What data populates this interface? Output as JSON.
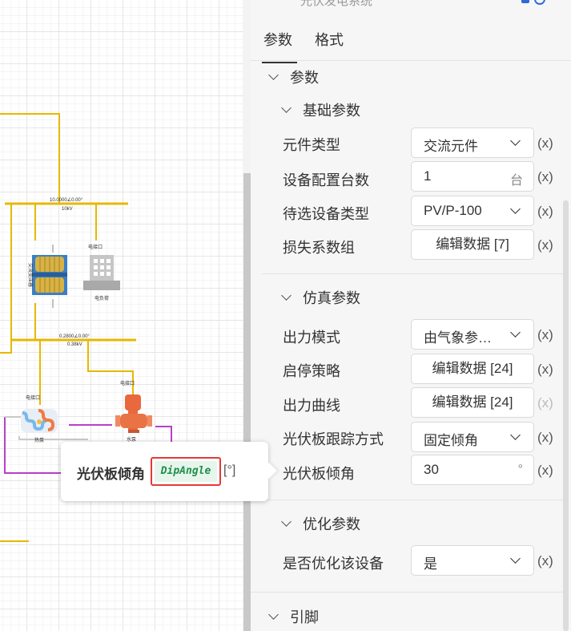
{
  "panel": {
    "title": "光伏发电系统",
    "tabs": [
      {
        "label": "参数",
        "active": true
      },
      {
        "label": "格式",
        "active": false
      }
    ]
  },
  "sections": {
    "params_label": "参数",
    "basic_label": "基础参数",
    "sim_label": "仿真参数",
    "opt_label": "优化参数",
    "pins_label": "引脚"
  },
  "basic_rows": [
    {
      "label": "元件类型",
      "type": "select",
      "value": "交流元件",
      "x": "(x)"
    },
    {
      "label": "设备配置台数",
      "type": "number",
      "value": "1",
      "unit": "台",
      "x": "(x)"
    },
    {
      "label": "待选设备类型",
      "type": "select",
      "value": "PV/P-100",
      "x": "(x)"
    },
    {
      "label": "损失系数组",
      "type": "button",
      "value": "编辑数据 [7]",
      "x": "(x)"
    }
  ],
  "sim_rows": [
    {
      "label": "出力模式",
      "type": "select",
      "value": "由气象参…",
      "x": "(x)"
    },
    {
      "label": "启停策略",
      "type": "button",
      "value": "编辑数据 [24]",
      "x": "(x)"
    },
    {
      "label": "出力曲线",
      "type": "button",
      "value": "编辑数据 [24]",
      "x": "(x)",
      "dim": true
    },
    {
      "label": "光伏板跟踪方式",
      "type": "select",
      "value": "固定倾角",
      "x": "(x)"
    },
    {
      "label": "光伏板倾角",
      "type": "number",
      "value": "30",
      "unit": "°",
      "x": "(x)"
    }
  ],
  "opt_rows": [
    {
      "label": "是否优化该设备",
      "type": "select",
      "value": "是",
      "x": "(x)"
    }
  ],
  "tooltip": {
    "label": "光伏板倾角",
    "code": "DipAngle",
    "unit": "[°]"
  },
  "diagram": {
    "bus1_label": "10.0000∠0.00°",
    "bus1_sub": "10kV",
    "bus2_label": "0.2800∠0.00°",
    "bus2_sub": "0.38kV",
    "load_label": "电负荷",
    "load_port": "电接口",
    "transformer_label": "交流变压器",
    "pump_label": "水泵",
    "pump_port": "电接口",
    "heatpump_label": "热泵",
    "heatpump_port": "电接口",
    "colors": {
      "elec": "#e6b800",
      "water": "#b83fc8",
      "pipe": "#c9c9c9"
    }
  }
}
